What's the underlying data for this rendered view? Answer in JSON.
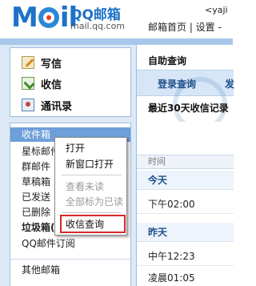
{
  "header": {
    "logo_text": "MOil",
    "brand_name": "QQ邮箱",
    "brand_domain": "mail.qq.com",
    "user": "<yaji",
    "links": "邮箱首页 | 设置 -"
  },
  "quick_actions": [
    {
      "label": "写信",
      "icon": "write-icon"
    },
    {
      "label": "收信",
      "icon": "inbox-icon"
    },
    {
      "label": "通讯录",
      "icon": "contacts-icon"
    }
  ],
  "folders": {
    "inbox": "收件箱",
    "starred": "星标邮件",
    "group": "群邮件",
    "drafts": "草稿箱",
    "sent": "已发送",
    "deleted": "已删除",
    "junk": "垃圾箱(",
    "subscriptions": "QQ邮件订阅",
    "other": "其他邮箱"
  },
  "context_menu": {
    "open": "打开",
    "open_new_window": "新窗口打开",
    "view_unread": "查看未读",
    "mark_all_read": "全部标为已读",
    "receipt_query": "收信查询"
  },
  "right_panel": {
    "title": "自助查询",
    "tabs": [
      "登录查询",
      "发"
    ],
    "description": "最近30天收信记录",
    "column_time": "时间",
    "groups": {
      "today": "今天",
      "yesterday": "昨天"
    },
    "rows": {
      "today_1": "下午02:00",
      "yesterday_1": "中午12:23",
      "yesterday_2": "凌晨01:05"
    }
  },
  "colors": {
    "brand_blue": "#1e72c8",
    "selected_folder": "#6d9fd9",
    "highlight_box": "#d42a2a"
  }
}
